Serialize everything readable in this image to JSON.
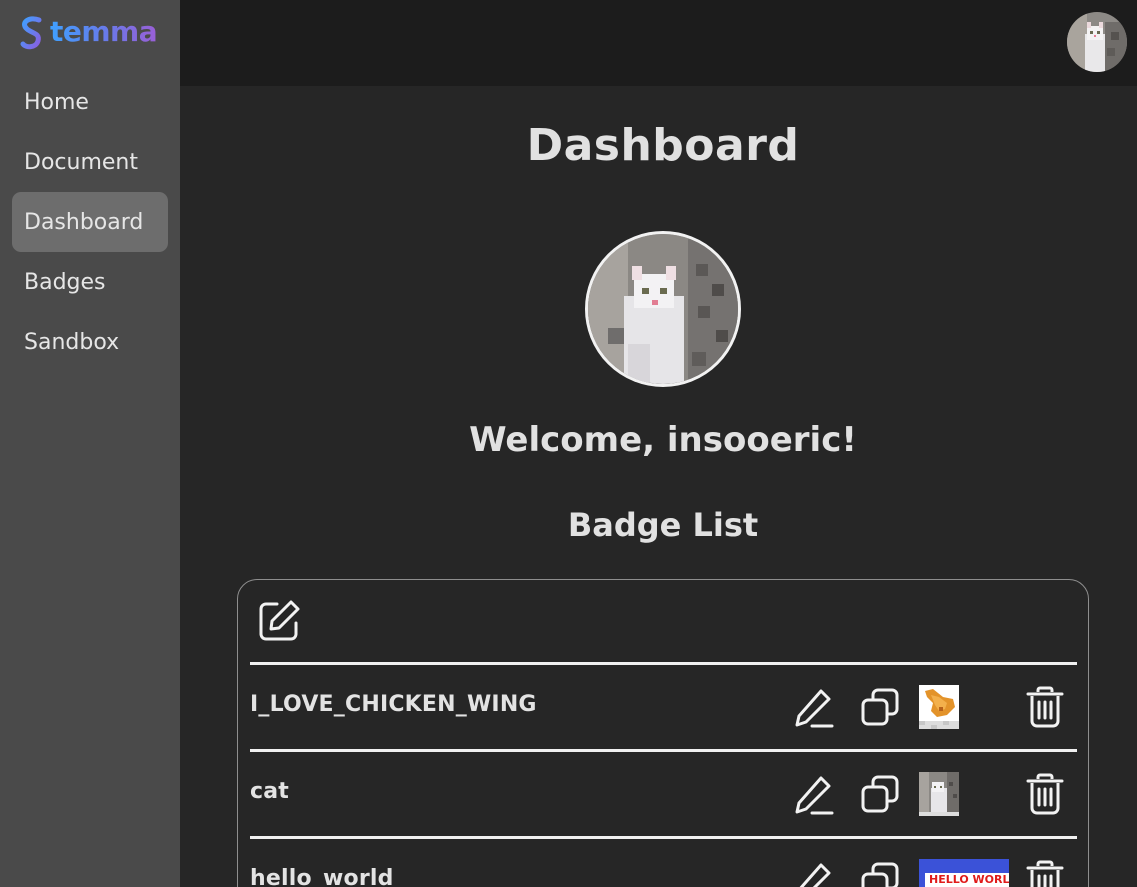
{
  "app": {
    "logo_text": "temma"
  },
  "sidebar": {
    "items": [
      {
        "label": "Home"
      },
      {
        "label": "Document"
      },
      {
        "label": "Dashboard",
        "active": true
      },
      {
        "label": "Badges"
      },
      {
        "label": "Sandbox"
      }
    ]
  },
  "header": {
    "avatar_icon": "user-avatar-cat"
  },
  "main": {
    "title": "Dashboard",
    "welcome": "Welcome, insooeric!",
    "badge_list_title": "Badge List",
    "badges": [
      {
        "name": "I_LOVE_CHICKEN_WING",
        "image": "chicken-wing"
      },
      {
        "name": "cat",
        "image": "cat"
      },
      {
        "name": "hello_world",
        "image": "hello-world",
        "image_text": "HELLO WORLD"
      }
    ]
  },
  "colors": {
    "sidebar_bg": "#4a4a4a",
    "active_nav_bg": "#6d6d6d",
    "topbar_bg": "#1c1c1c",
    "main_bg": "#262626",
    "logo_gradient_start": "#3fa0ff",
    "logo_gradient_end": "#9a5fd6"
  }
}
